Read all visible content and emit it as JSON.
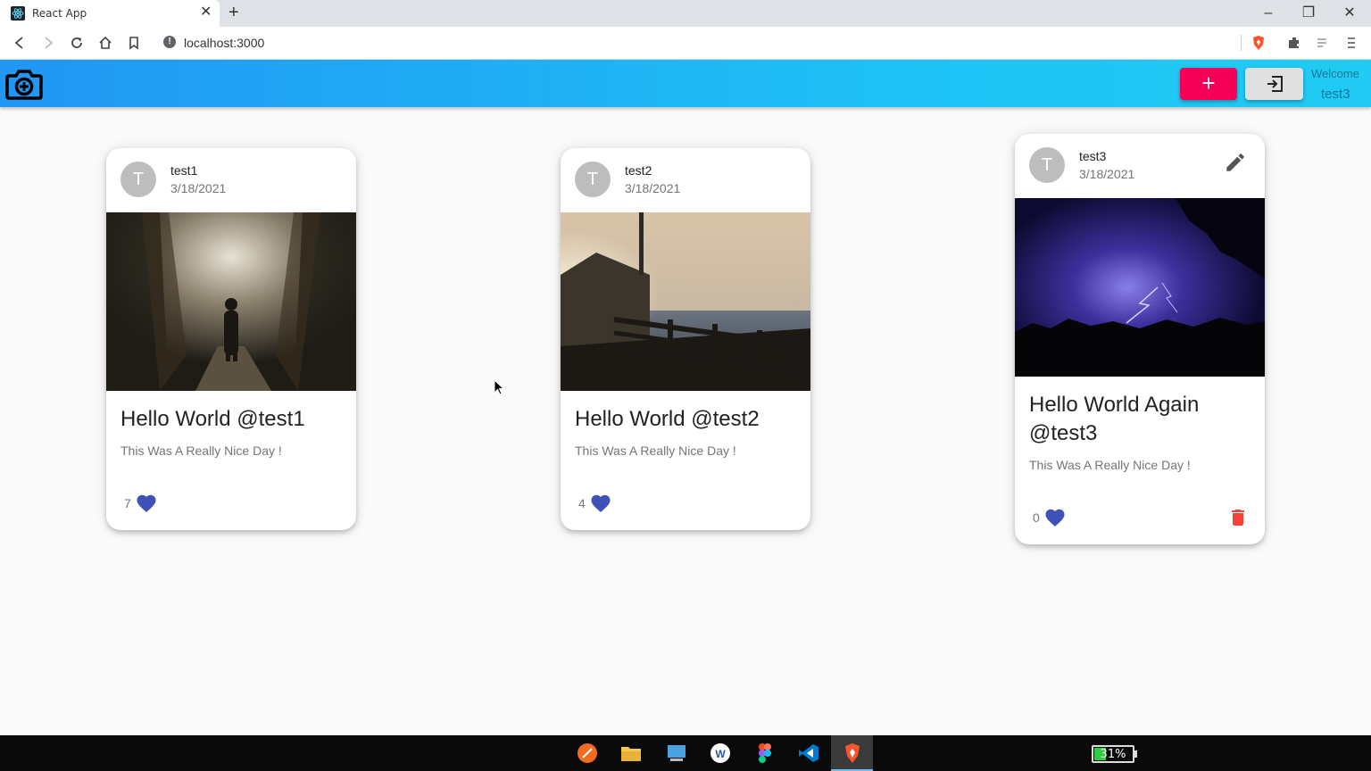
{
  "browser": {
    "tab_title": "React App",
    "url": "localhost:3000"
  },
  "appbar": {
    "welcome_label": "Welcome",
    "username": "test3",
    "add_label": "+"
  },
  "posts": [
    {
      "user": "test1",
      "initial": "T",
      "date": "3/18/2021",
      "title": "Hello World @test1",
      "body": "This Was A Really Nice Day !",
      "likes": "7",
      "image": "forest-path-photo"
    },
    {
      "user": "test2",
      "initial": "T",
      "date": "3/18/2021",
      "title": "Hello World @test2",
      "body": "This Was A Really Nice Day !",
      "likes": "4",
      "image": "pier-house-photo"
    },
    {
      "user": "test3",
      "initial": "T",
      "date": "3/18/2021",
      "title": "Hello World Again @test3",
      "body": "This Was A Really Nice Day !",
      "likes": "0",
      "image": "lightning-storm-photo"
    }
  ],
  "taskbar": {
    "battery": "31%",
    "battery_level": 0.31,
    "apps": [
      "browser-icon",
      "file-explorer-icon",
      "desktop-icon",
      "wordpad-icon",
      "figma-icon",
      "vscode-icon",
      "brave-icon"
    ]
  },
  "colors": {
    "appbar_start": "#2196f3",
    "appbar_end": "#21cbf3",
    "add_button": "#f50057",
    "heart": "#3f51b5",
    "delete": "#f44336"
  }
}
